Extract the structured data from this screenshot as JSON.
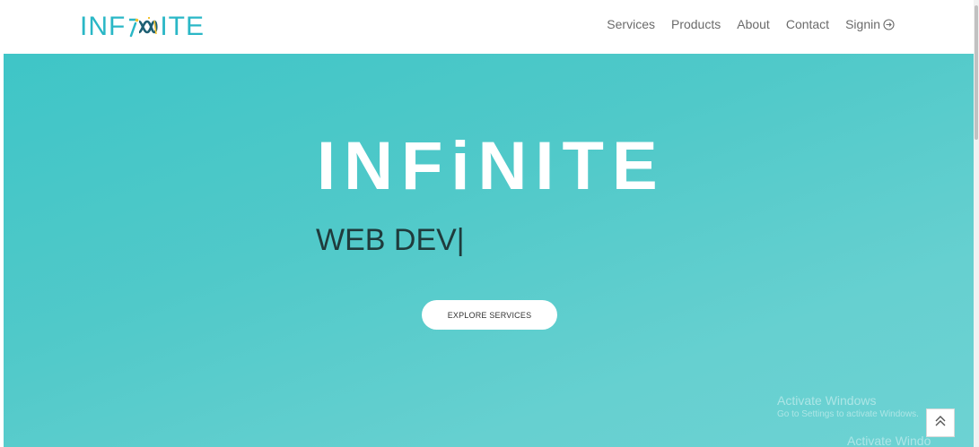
{
  "header": {
    "logo": {
      "prefix": "INF",
      "suffix": "ITE",
      "mark_icon": "infinity-mark-icon"
    },
    "nav": [
      {
        "label": "Services"
      },
      {
        "label": "Products"
      },
      {
        "label": "About"
      },
      {
        "label": "Contact"
      },
      {
        "label": "Signin",
        "icon": "signin-arrow-icon"
      }
    ]
  },
  "hero": {
    "title": "INFiNITE",
    "subtitle": "WEB DEV|",
    "cta_label": "EXPLORE SERVICES"
  },
  "os_watermark": {
    "title": "Activate Windows",
    "subtitle": "Go to Settings to activate Windows.",
    "title_repeat": "Activate Windo"
  },
  "scroll_top_icon": "double-chevron-up-icon",
  "colors": {
    "brand_teal": "#2ab7c6",
    "brand_yellow": "#f2c230",
    "hero_start": "#3fc5c7",
    "hero_end": "#6dd2d3",
    "subtitle_text": "#1f3b3c",
    "nav_text": "#6b6b6b"
  }
}
